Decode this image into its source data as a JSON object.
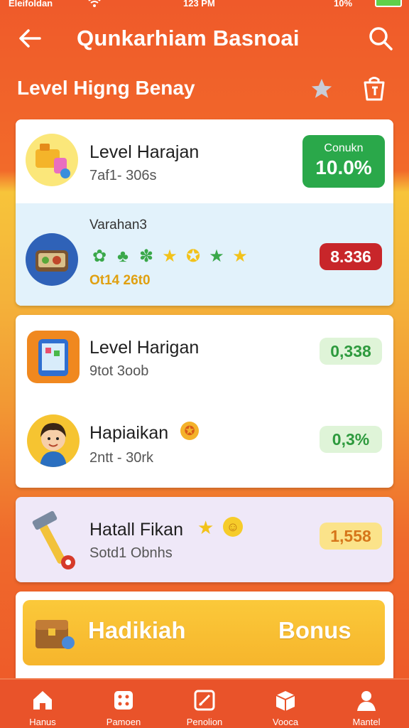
{
  "status_bar": {
    "carrier": "Eleifoldan",
    "time": "123 PM",
    "battery": "10%"
  },
  "app_bar": {
    "title": "Qunkarhiam Basnoai"
  },
  "header": {
    "title": "Level Higng Benay"
  },
  "card1": {
    "row1": {
      "title": "Level Harajan",
      "subtitle": "7af1- 306s",
      "badge_label": "Conukn",
      "badge_value": "10.0%"
    },
    "row2": {
      "title": "Varahan3",
      "stat": "Ot14 26t0",
      "badge_value": "8.336"
    }
  },
  "card2": {
    "row1": {
      "title": "Level Harigan",
      "subtitle": "9tot 3oob",
      "badge_value": "0,338"
    },
    "row2": {
      "title": "Hapiaikan",
      "subtitle": "2ntt - 30rk",
      "badge_value": "0,3%"
    }
  },
  "card3": {
    "title": "Hatall Fikan",
    "subtitle": "Sotd1 Obnhs",
    "badge_value": "1,558"
  },
  "banner": {
    "title": "Hadikiah",
    "bonus": "Bonus"
  },
  "nav": [
    {
      "label": "Hanus",
      "icon": "home-icon"
    },
    {
      "label": "Pamoen",
      "icon": "dice-icon"
    },
    {
      "label": "Penolion",
      "icon": "edit-icon"
    },
    {
      "label": "Vooca",
      "icon": "box-icon"
    },
    {
      "label": "Mantel",
      "icon": "profile-icon"
    }
  ],
  "colors": {
    "primary": "#ef5a2a",
    "green_badge": "#2aa84a",
    "red_badge": "#cc2a2a",
    "card_blue": "#e2f2fb",
    "card_purple": "#efe8f8",
    "banner": "#f6b52c"
  }
}
